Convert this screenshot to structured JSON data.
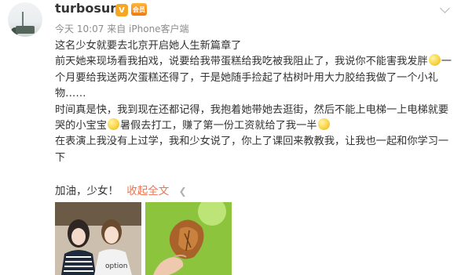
{
  "user": {
    "name": "turbosun",
    "verified_badge": "V",
    "member_badge": "会员"
  },
  "meta": {
    "time": "今天 10:07",
    "source": "来自 iPhone客户端"
  },
  "post": {
    "line1": "这名少女就要去北京开启她人生新篇章了",
    "para2_a": "前天她来现场看我拍戏，说要给我带蛋糕给我吃被我阻止了，我说你不能害我发胖",
    "para2_b": "一个月要给我送两次蛋糕还得了，于是她随手捡起了枯树叶用大力胶给我做了一个小礼物……",
    "para3_a": "时间真是快，我到现在还都记得，我抱着她带她去逛街，然后不能上电梯一上电梯就要哭的小宝宝",
    "para3_b": "暑假去打工，赚了第一份工资就给了我一半",
    "para4": "在表演上我没有上过学，我和少女说了，你上了课回来教教我，让我也一起和你学习一下",
    "emoji_icon": "smile-emoji"
  },
  "actions": {
    "cheer_text": "加油，少女！",
    "collapse_label": "收起全文",
    "collapse_icon": "chevron-up"
  },
  "photo_shirt_text": "option"
}
